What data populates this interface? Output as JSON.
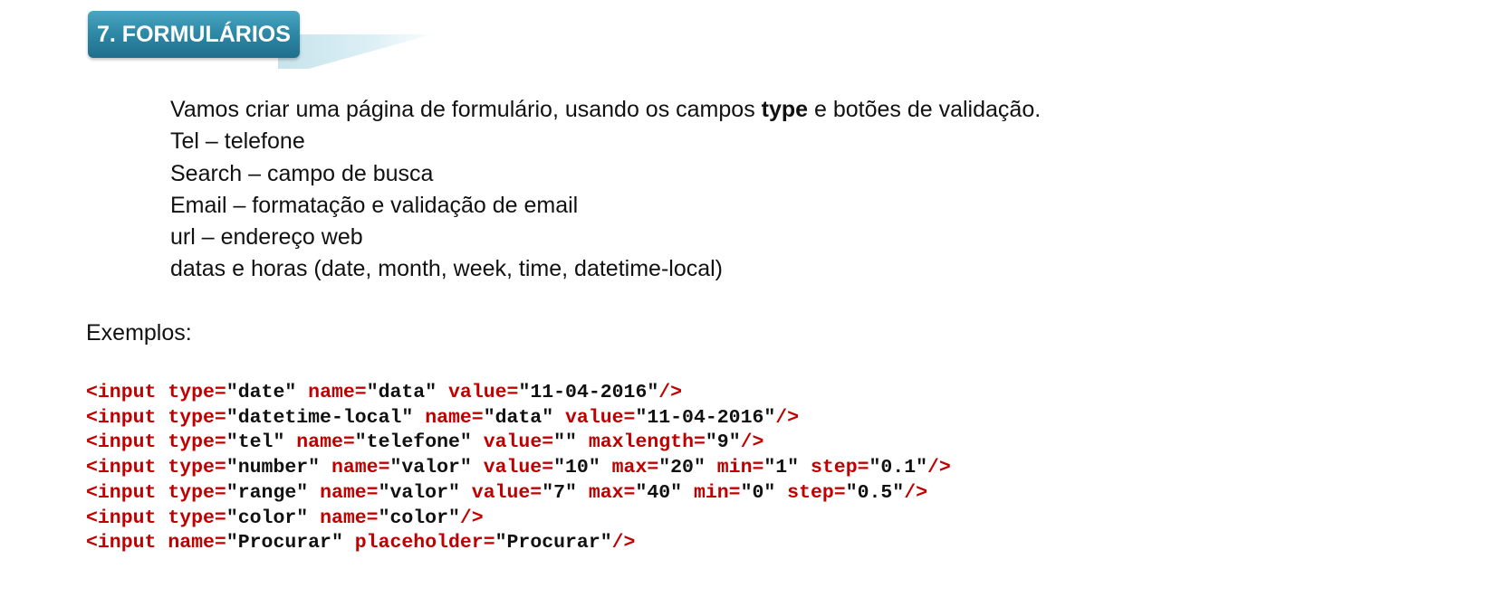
{
  "section": {
    "title": "7. FORMULÁRIOS"
  },
  "intro": {
    "sentence_before": "Vamos criar uma página de formulário, usando os campos ",
    "sentence_bold": "type",
    "sentence_after": " e botões de validação.",
    "items": [
      "Tel – telefone",
      "Search – campo de busca",
      "Email – formatação e validação de email",
      "url – endereço web",
      "datas e horas (date, month, week, time, datetime-local)"
    ]
  },
  "examples_label": "Exemplos:",
  "code_lines": [
    [
      {
        "t": "tag",
        "v": "<input "
      },
      {
        "t": "attr",
        "v": "type="
      },
      {
        "t": "val",
        "v": "\"date\" "
      },
      {
        "t": "attr",
        "v": "name="
      },
      {
        "t": "val",
        "v": "\"data\" "
      },
      {
        "t": "attr",
        "v": "value="
      },
      {
        "t": "val",
        "v": "\"11-04-2016\""
      },
      {
        "t": "close",
        "v": "/>"
      }
    ],
    [
      {
        "t": "tag",
        "v": "<input "
      },
      {
        "t": "attr",
        "v": "type="
      },
      {
        "t": "val",
        "v": "\"datetime-local\" "
      },
      {
        "t": "attr",
        "v": "name="
      },
      {
        "t": "val",
        "v": "\"data\" "
      },
      {
        "t": "attr",
        "v": "value="
      },
      {
        "t": "val",
        "v": "\"11-04-2016\""
      },
      {
        "t": "close",
        "v": "/>"
      }
    ],
    [
      {
        "t": "tag",
        "v": "<input "
      },
      {
        "t": "attr",
        "v": "type="
      },
      {
        "t": "val",
        "v": "\"tel\" "
      },
      {
        "t": "attr",
        "v": "name="
      },
      {
        "t": "val",
        "v": "\"telefone\" "
      },
      {
        "t": "attr",
        "v": "value="
      },
      {
        "t": "val",
        "v": "\"\" "
      },
      {
        "t": "attr",
        "v": "maxlength="
      },
      {
        "t": "val",
        "v": "\"9\""
      },
      {
        "t": "close",
        "v": "/>"
      }
    ],
    [
      {
        "t": "tag",
        "v": "<input "
      },
      {
        "t": "attr",
        "v": "type="
      },
      {
        "t": "val",
        "v": "\"number\" "
      },
      {
        "t": "attr",
        "v": "name="
      },
      {
        "t": "val",
        "v": "\"valor\" "
      },
      {
        "t": "attr",
        "v": "value="
      },
      {
        "t": "val",
        "v": "\"10\" "
      },
      {
        "t": "attr",
        "v": "max="
      },
      {
        "t": "val",
        "v": "\"20\" "
      },
      {
        "t": "attr",
        "v": "min="
      },
      {
        "t": "val",
        "v": "\"1\" "
      },
      {
        "t": "attr",
        "v": "step="
      },
      {
        "t": "val",
        "v": "\"0.1\""
      },
      {
        "t": "close",
        "v": "/>"
      }
    ],
    [
      {
        "t": "tag",
        "v": "<input "
      },
      {
        "t": "attr",
        "v": "type="
      },
      {
        "t": "val",
        "v": "\"range\" "
      },
      {
        "t": "attr",
        "v": "name="
      },
      {
        "t": "val",
        "v": "\"valor\" "
      },
      {
        "t": "attr",
        "v": "value="
      },
      {
        "t": "val",
        "v": "\"7\" "
      },
      {
        "t": "attr",
        "v": "max="
      },
      {
        "t": "val",
        "v": "\"40\" "
      },
      {
        "t": "attr",
        "v": "min="
      },
      {
        "t": "val",
        "v": "\"0\" "
      },
      {
        "t": "attr",
        "v": "step="
      },
      {
        "t": "val",
        "v": "\"0.5\""
      },
      {
        "t": "close",
        "v": "/>"
      }
    ],
    [
      {
        "t": "tag",
        "v": "<input "
      },
      {
        "t": "attr",
        "v": "type="
      },
      {
        "t": "val",
        "v": "\"color\" "
      },
      {
        "t": "attr",
        "v": "name="
      },
      {
        "t": "val",
        "v": "\"color\""
      },
      {
        "t": "close",
        "v": "/>"
      }
    ],
    [
      {
        "t": "tag",
        "v": "<input "
      },
      {
        "t": "attr",
        "v": "name="
      },
      {
        "t": "val",
        "v": "\"Procurar\" "
      },
      {
        "t": "attr",
        "v": "placeholder="
      },
      {
        "t": "val",
        "v": "\"Procurar\""
      },
      {
        "t": "close",
        "v": "/>"
      }
    ]
  ],
  "colors": {
    "code_keyword": "#c00000",
    "code_value": "#111111",
    "header_badge": "#2f8aa8",
    "header_tail": "#c7e3ec"
  }
}
